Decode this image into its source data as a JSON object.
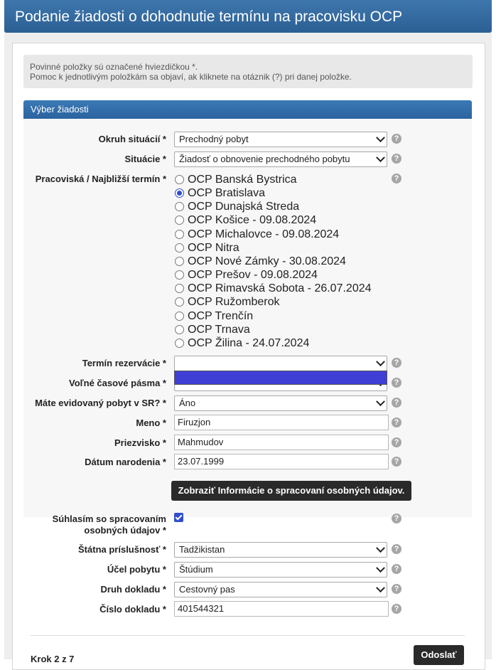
{
  "header": {
    "title": "Podanie žiadosti o dohodnutie termínu na pracovisku OCP"
  },
  "info": {
    "line1": "Povinné položky sú označené hviezdičkou *.",
    "line2": "Pomoc k jednotlivým položkám sa objaví, ak kliknete na otáznik (?) pri danej položke."
  },
  "section": {
    "title": "Výber žiadosti"
  },
  "help_glyph": "?",
  "fields": {
    "okruh": {
      "label": "Okruh situácií *",
      "value": "Prechodný pobyt"
    },
    "situacie": {
      "label": "Situácie *",
      "value": "Žiadosť o obnovenie prechodného pobytu"
    },
    "pracoviska": {
      "label": "Pracoviská / Najbližší termín *",
      "options": [
        {
          "label": "OCP Banská Bystrica",
          "selected": false
        },
        {
          "label": "OCP Bratislava",
          "selected": true
        },
        {
          "label": "OCP Dunajská Streda",
          "selected": false
        },
        {
          "label": "OCP Košice - 09.08.2024",
          "selected": false
        },
        {
          "label": "OCP Michalovce - 09.08.2024",
          "selected": false
        },
        {
          "label": "OCP Nitra",
          "selected": false
        },
        {
          "label": "OCP Nové Zámky - 30.08.2024",
          "selected": false
        },
        {
          "label": "OCP Prešov - 09.08.2024",
          "selected": false
        },
        {
          "label": "OCP Rimavská Sobota - 26.07.2024",
          "selected": false
        },
        {
          "label": "OCP Ružomberok",
          "selected": false
        },
        {
          "label": "OCP Trenčín",
          "selected": false
        },
        {
          "label": "OCP Trnava",
          "selected": false
        },
        {
          "label": "OCP Žilina - 24.07.2024",
          "selected": false
        }
      ]
    },
    "termin": {
      "label": "Termín rezervácie *",
      "value": ""
    },
    "volne": {
      "label": "Voľné časové pásma *",
      "value": ""
    },
    "pobyt_sr": {
      "label": "Máte evidovaný pobyt v SR? *",
      "value": "Áno"
    },
    "meno": {
      "label": "Meno *",
      "value": "Firuzjon"
    },
    "priezvisko": {
      "label": "Priezvisko *",
      "value": "Mahmudov"
    },
    "datum": {
      "label": "Dátum narodenia *",
      "value": "23.07.1999"
    },
    "gdpr_button": "Zobraziť Informácie o spracovaní osobných údajov.",
    "suhlas": {
      "label_line1": "Súhlasím so spracovaním",
      "label_line2": "osobných údajov *",
      "checked": true
    },
    "statna": {
      "label": "Štátna príslušnosť *",
      "value": "Tadžikistan"
    },
    "ucel": {
      "label": "Účel pobytu *",
      "value": "Štúdium"
    },
    "druh": {
      "label": "Druh dokladu *",
      "value": "Cestovný pas"
    },
    "cislo": {
      "label": "Číslo dokladu *",
      "value": "401544321"
    }
  },
  "footer": {
    "step": "Krok 2 z 7",
    "submit": "Odoslať"
  },
  "colors": {
    "header": "#2f67a0",
    "selected": "#3f3fd6"
  }
}
